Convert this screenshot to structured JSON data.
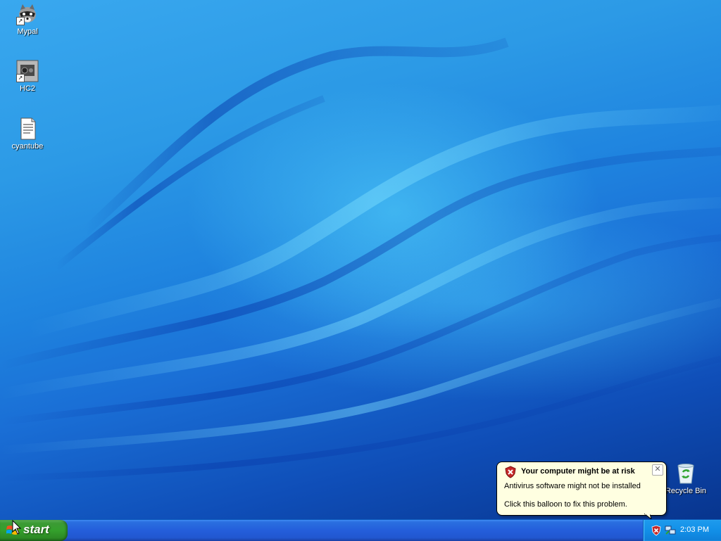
{
  "desktop": {
    "icons": [
      {
        "label": "Mypal",
        "icon": "raccoon-icon"
      },
      {
        "label": "HC2",
        "icon": "app-icon"
      },
      {
        "label": "cyantube",
        "icon": "document-icon"
      },
      {
        "label": "Recycle Bin",
        "icon": "recycle-bin-icon"
      }
    ]
  },
  "balloon": {
    "title": "Your computer might be at risk",
    "line1": "Antivirus software might not be installed",
    "line2": "Click this balloon to fix this problem.",
    "close_label": "✕",
    "icon": "security-shield-icon"
  },
  "taskbar": {
    "start_label": "start",
    "clock": "2:03 PM",
    "tray_icons": [
      "security-alert-icon",
      "network-icon"
    ]
  },
  "colors": {
    "taskbar": "#245edb",
    "start_button": "#34a02c",
    "balloon_bg": "#ffffe1",
    "tray": "#1290e8"
  }
}
